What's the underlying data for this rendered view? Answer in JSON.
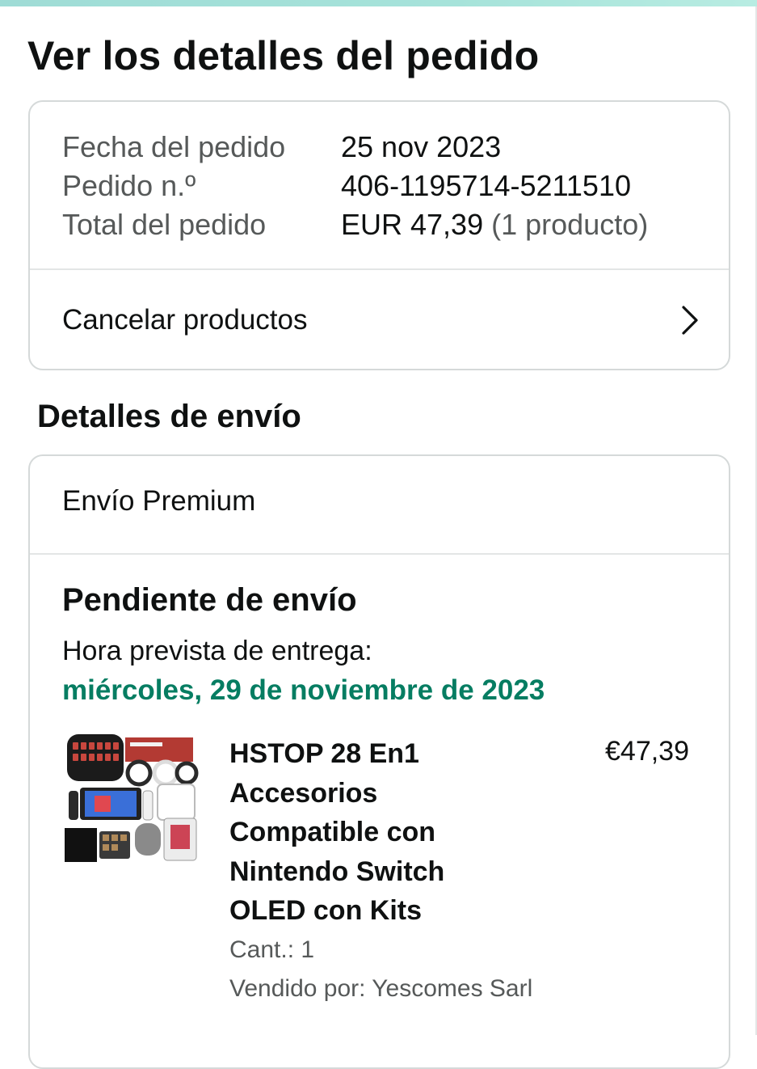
{
  "header": {
    "title": "Ver los detalles del pedido"
  },
  "order_summary": {
    "date_label": "Fecha del pedido",
    "date_value": "25 nov 2023",
    "number_label": "Pedido n.º",
    "number_value": "406-1195714-5211510",
    "total_label": "Total del pedido",
    "total_value": "EUR 47,39",
    "total_count": "(1 producto)",
    "cancel_label": "Cancelar productos",
    "cancel_icon": "chevron-right-icon"
  },
  "shipping": {
    "section_title": "Detalles de envío",
    "method": "Envío Premium",
    "status": "Pendiente de envío",
    "delivery_label": "Hora prevista de entrega:",
    "delivery_date": "miércoles, 29 de noviembre de 2023",
    "delivery_date_color": "#067d62",
    "product": {
      "title": "HSTOP 28 En1 Accesorios Compatible con Nintendo Switch OLED con Kits",
      "price": "€47,39",
      "quantity": "Cant.: 1",
      "seller": "Vendido por: Yescomes Sarl",
      "image_icon": "product-thumbnail"
    }
  },
  "colors": {
    "accent_strip": "#a6e3da",
    "card_border": "#d5d9d9",
    "muted_text": "#565959"
  }
}
